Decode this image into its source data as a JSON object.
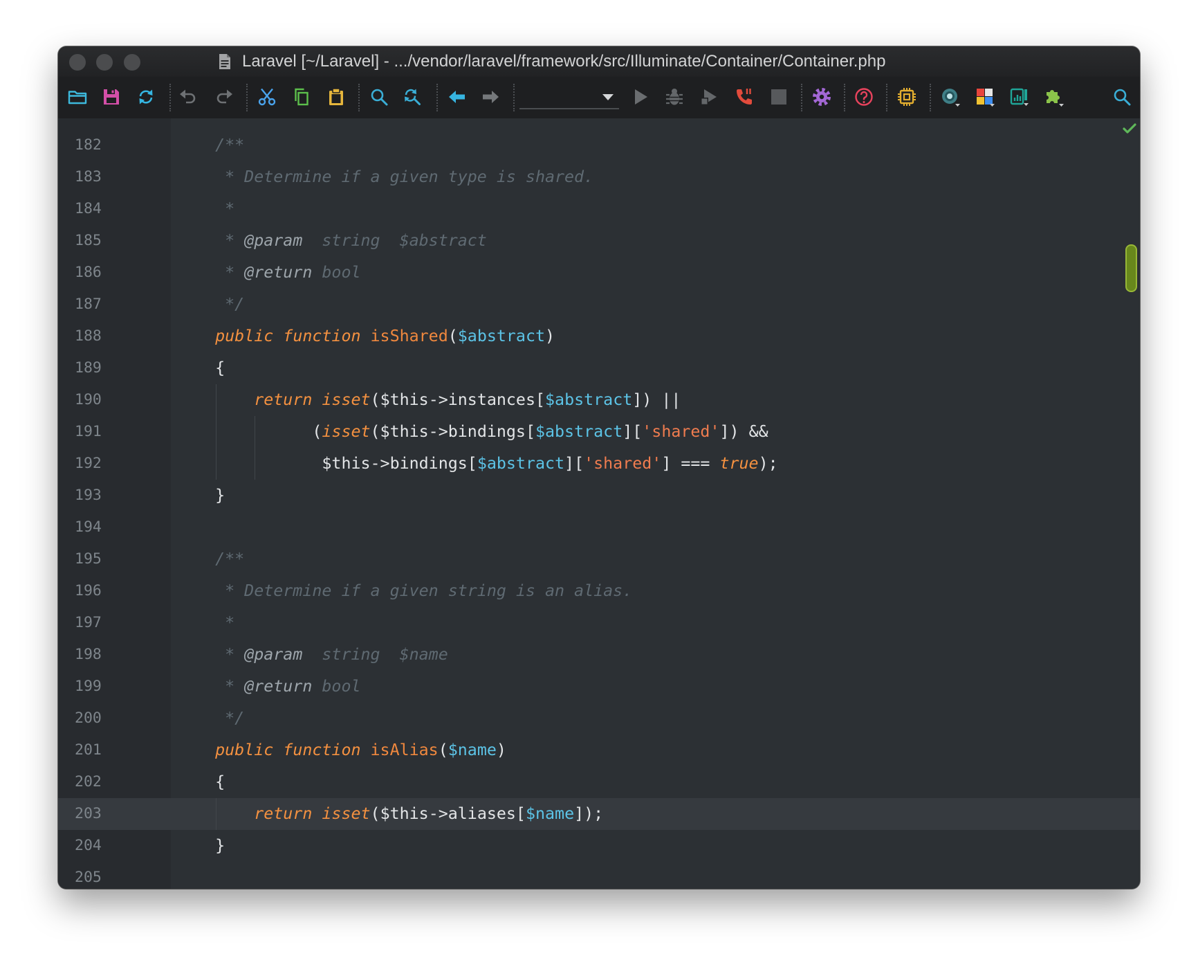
{
  "window": {
    "title": "Laravel [~/Laravel] - .../vendor/laravel/framework/src/Illuminate/Container/Container.php",
    "file_icon": "php-file-icon",
    "controls": [
      "close-button",
      "minimize-button",
      "zoom-button"
    ]
  },
  "toolbar": {
    "icons": [
      "open-folder-icon",
      "save-icon",
      "sync-icon",
      "undo-icon",
      "redo-icon",
      "cut-icon",
      "copy-icon",
      "paste-icon",
      "find-icon",
      "replace-icon",
      "back-arrow-icon",
      "forward-arrow-icon",
      "run-icon",
      "debug-icon",
      "run-with-coverage-icon",
      "phone-icon",
      "stop-icon",
      "settings-gear-icon",
      "help-icon",
      "cpu-icon",
      "record-icon",
      "layout-icon",
      "analyzer-icon",
      "plugin-icon",
      "search-everywhere-icon"
    ],
    "run_configuration": ""
  },
  "editor": {
    "current_line": "203",
    "status_icon": "inspection-ok-check-icon",
    "lines": [
      {
        "n": "182",
        "t": [
          [
            "    /**",
            "comment"
          ]
        ]
      },
      {
        "n": "183",
        "t": [
          [
            "     * Determine if a given type is shared.",
            "comment"
          ]
        ]
      },
      {
        "n": "184",
        "t": [
          [
            "     *",
            "comment"
          ]
        ]
      },
      {
        "n": "185",
        "t": [
          [
            "     * ",
            "comment"
          ],
          [
            "@param",
            "doctag"
          ],
          [
            "  string  $abstract",
            "comment"
          ]
        ]
      },
      {
        "n": "186",
        "t": [
          [
            "     * ",
            "comment"
          ],
          [
            "@return",
            "doctag"
          ],
          [
            " bool",
            "comment"
          ]
        ]
      },
      {
        "n": "187",
        "t": [
          [
            "     */",
            "comment"
          ]
        ]
      },
      {
        "n": "188",
        "t": [
          [
            "    ",
            "plain"
          ],
          [
            "public function ",
            "keyword"
          ],
          [
            "isShared",
            "function"
          ],
          [
            "(",
            "plain"
          ],
          [
            "$abstract",
            "variable"
          ],
          [
            ")",
            "plain"
          ]
        ]
      },
      {
        "n": "189",
        "t": [
          [
            "    {",
            "plain"
          ]
        ]
      },
      {
        "n": "190",
        "t": [
          [
            "        ",
            "plain"
          ],
          [
            "return",
            "keyword"
          ],
          [
            " ",
            "plain"
          ],
          [
            "isset",
            "keyword"
          ],
          [
            "($this->instances[",
            "plain"
          ],
          [
            "$abstract",
            "variable"
          ],
          [
            "]) ||",
            "plain"
          ]
        ]
      },
      {
        "n": "191",
        "t": [
          [
            "              (",
            "plain"
          ],
          [
            "isset",
            "keyword"
          ],
          [
            "($this->bindings[",
            "plain"
          ],
          [
            "$abstract",
            "variable"
          ],
          [
            "][",
            "plain"
          ],
          [
            "'shared'",
            "string"
          ],
          [
            "]) &&",
            "plain"
          ]
        ]
      },
      {
        "n": "192",
        "t": [
          [
            "               $this->bindings[",
            "plain"
          ],
          [
            "$abstract",
            "variable"
          ],
          [
            "][",
            "plain"
          ],
          [
            "'shared'",
            "string"
          ],
          [
            "] === ",
            "plain"
          ],
          [
            "true",
            "keyword"
          ],
          [
            ");",
            "plain"
          ]
        ]
      },
      {
        "n": "193",
        "t": [
          [
            "    }",
            "plain"
          ]
        ]
      },
      {
        "n": "194",
        "t": []
      },
      {
        "n": "195",
        "t": [
          [
            "    /**",
            "comment"
          ]
        ]
      },
      {
        "n": "196",
        "t": [
          [
            "     * Determine if a given string is an alias.",
            "comment"
          ]
        ]
      },
      {
        "n": "197",
        "t": [
          [
            "     *",
            "comment"
          ]
        ]
      },
      {
        "n": "198",
        "t": [
          [
            "     * ",
            "comment"
          ],
          [
            "@param",
            "doctag"
          ],
          [
            "  string  $name",
            "comment"
          ]
        ]
      },
      {
        "n": "199",
        "t": [
          [
            "     * ",
            "comment"
          ],
          [
            "@return",
            "doctag"
          ],
          [
            " bool",
            "comment"
          ]
        ]
      },
      {
        "n": "200",
        "t": [
          [
            "     */",
            "comment"
          ]
        ]
      },
      {
        "n": "201",
        "t": [
          [
            "    ",
            "plain"
          ],
          [
            "public function ",
            "keyword"
          ],
          [
            "isAlias",
            "function"
          ],
          [
            "(",
            "plain"
          ],
          [
            "$name",
            "variable"
          ],
          [
            ")",
            "plain"
          ]
        ]
      },
      {
        "n": "202",
        "t": [
          [
            "    {",
            "plain"
          ]
        ]
      },
      {
        "n": "203",
        "t": [
          [
            "        ",
            "plain"
          ],
          [
            "return",
            "keyword"
          ],
          [
            " ",
            "plain"
          ],
          [
            "isset",
            "keyword"
          ],
          [
            "($this->aliases[",
            "plain"
          ],
          [
            "$name",
            "variable"
          ],
          [
            "]);",
            "plain"
          ]
        ]
      },
      {
        "n": "204",
        "t": [
          [
            "    }",
            "plain"
          ]
        ]
      },
      {
        "n": "205",
        "t": []
      }
    ]
  },
  "colors": {
    "plain": "#e3e5e7",
    "keyword": "#f49140",
    "function": "#f0883e",
    "string": "#ef7c4f",
    "variable": "#5cc3e6",
    "comment": "#5f6a72",
    "doctag": "#9ea6ac",
    "line_number": "#7e858b",
    "current_line": "#363a3f"
  }
}
